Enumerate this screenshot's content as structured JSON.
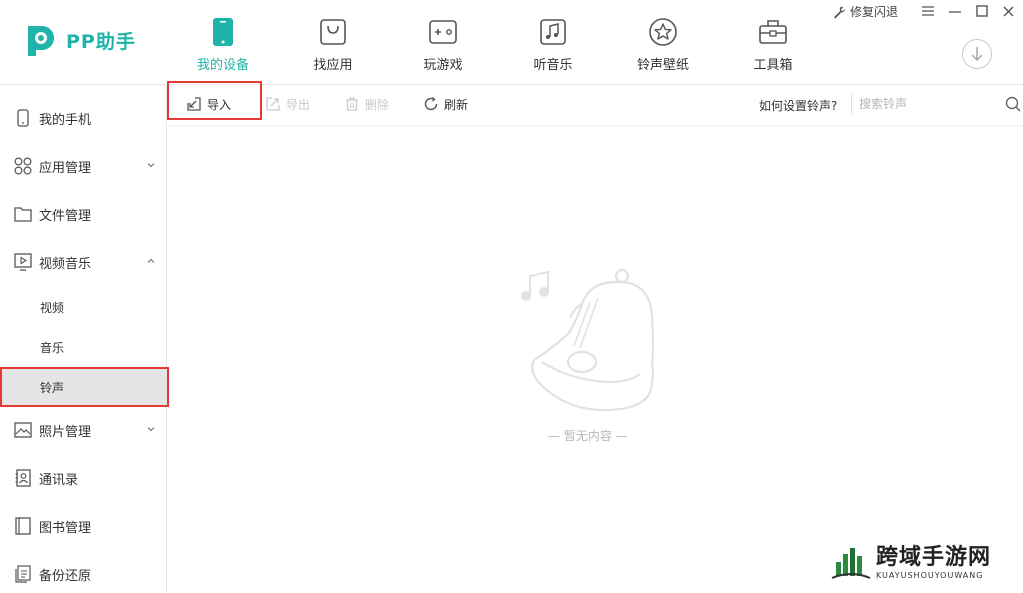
{
  "app": {
    "name": "PP助手",
    "brand_color": "#1fb3a9"
  },
  "nav": [
    {
      "label": "我的设备",
      "icon": "phone-icon",
      "active": true
    },
    {
      "label": "找应用",
      "icon": "bag-icon",
      "active": false
    },
    {
      "label": "玩游戏",
      "icon": "gamepad-icon",
      "active": false
    },
    {
      "label": "听音乐",
      "icon": "music-icon",
      "active": false
    },
    {
      "label": "铃声壁纸",
      "icon": "star-icon",
      "active": false
    },
    {
      "label": "工具箱",
      "icon": "toolbox-icon",
      "active": false
    }
  ],
  "window": {
    "repair_label": "修复闪退"
  },
  "sidebar": {
    "items": [
      {
        "label": "我的手机",
        "icon": "phone-icon"
      },
      {
        "label": "应用管理",
        "icon": "apps-icon"
      },
      {
        "label": "文件管理",
        "icon": "folder-icon"
      },
      {
        "label": "视频音乐",
        "icon": "video-icon"
      },
      {
        "label": "照片管理",
        "icon": "photo-icon"
      },
      {
        "label": "通讯录",
        "icon": "contacts-icon"
      },
      {
        "label": "图书管理",
        "icon": "book-icon"
      },
      {
        "label": "备份还原",
        "icon": "backup-icon"
      }
    ],
    "sub_items": [
      {
        "label": "视频"
      },
      {
        "label": "音乐"
      },
      {
        "label": "铃声",
        "selected": true
      }
    ]
  },
  "toolbar": {
    "import_label": "导入",
    "export_label": "导出",
    "delete_label": "删除",
    "refresh_label": "刷新",
    "howto_label": "如何设置铃声?",
    "search_placeholder": "搜索铃声"
  },
  "content": {
    "empty_text": "— 暂无内容 —"
  },
  "watermark": {
    "title": "跨域手游网",
    "subtitle": "KUAYUSHOUYOUWANG"
  }
}
